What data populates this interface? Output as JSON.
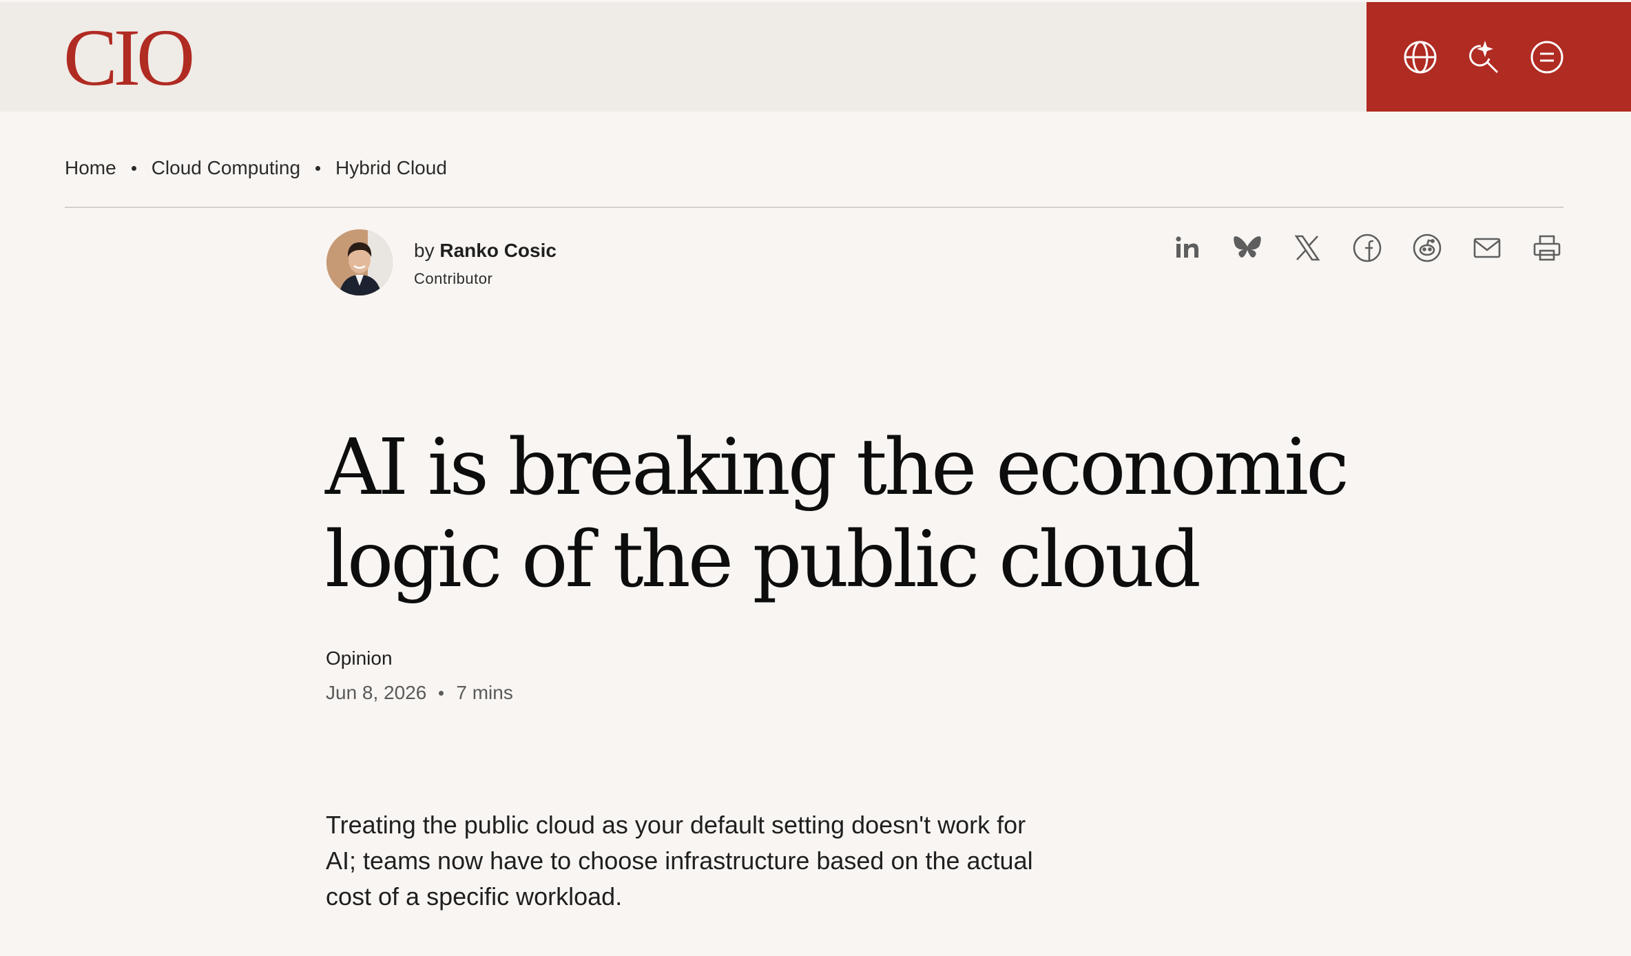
{
  "site": {
    "logo_text": "CIO",
    "brand_color": "#b02b22"
  },
  "header": {
    "icons": [
      "globe-icon",
      "ai-search-icon",
      "menu-icon"
    ]
  },
  "breadcrumb": {
    "items": [
      "Home",
      "Cloud Computing",
      "Hybrid Cloud"
    ]
  },
  "author": {
    "by_label": "by",
    "name": "Ranko Cosic",
    "role": "Contributor"
  },
  "share": {
    "icons": [
      "linkedin-icon",
      "bluesky-icon",
      "x-icon",
      "facebook-icon",
      "reddit-icon",
      "email-icon",
      "print-icon"
    ]
  },
  "article": {
    "title": "AI is breaking the economic logic of the public cloud",
    "type": "Opinion",
    "date": "Jun 8, 2026",
    "read_time": "7 mins",
    "dek": "Treating the public cloud as your default setting doesn't work for AI; teams now have to choose infrastructure based on the actual cost of a specific workload."
  }
}
